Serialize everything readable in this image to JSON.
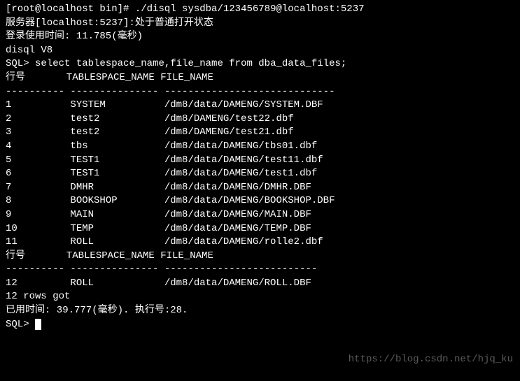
{
  "shell_prompt": "[root@localhost bin]# ",
  "command": "./disql sysdba/123456789@localhost:5237",
  "blank": "",
  "server_status": "服务器[localhost:5237]:处于普通打开状态",
  "login_time": "登录使用时间: 11.785(毫秒)",
  "version": "disql V8",
  "sql_prompt": "SQL> ",
  "sql_command": "select tablespace_name,file_name from dba_data_files;",
  "header1": "行号       TABLESPACE_NAME FILE_NAME",
  "divider1": "---------- --------------- -----------------------------",
  "rows1": [
    "1          SYSTEM          /dm8/data/DAMENG/SYSTEM.DBF",
    "2          test2           /dm8/DAMENG/test22.dbf",
    "3          test2           /dm8/DAMENG/test21.dbf",
    "4          tbs             /dm8/data/DAMENG/tbs01.dbf",
    "5          TEST1           /dm8/data/DAMENG/test11.dbf",
    "6          TEST1           /dm8/data/DAMENG/test1.dbf",
    "7          DMHR            /dm8/data/DAMENG/DMHR.DBF",
    "8          BOOKSHOP        /dm8/data/DAMENG/BOOKSHOP.DBF",
    "9          MAIN            /dm8/data/DAMENG/MAIN.DBF",
    "10         TEMP            /dm8/data/DAMENG/TEMP.DBF",
    "11         ROLL            /dm8/data/DAMENG/rolle2.dbf"
  ],
  "header2": "行号       TABLESPACE_NAME FILE_NAME",
  "divider2": "---------- --------------- --------------------------",
  "rows2": [
    "12         ROLL            /dm8/data/DAMENG/ROLL.DBF"
  ],
  "rows_got": "12 rows got",
  "elapsed": "已用时间: 39.777(毫秒). 执行号:28.",
  "next_prompt": "SQL> ",
  "watermark": "https://blog.csdn.net/hjq_ku"
}
